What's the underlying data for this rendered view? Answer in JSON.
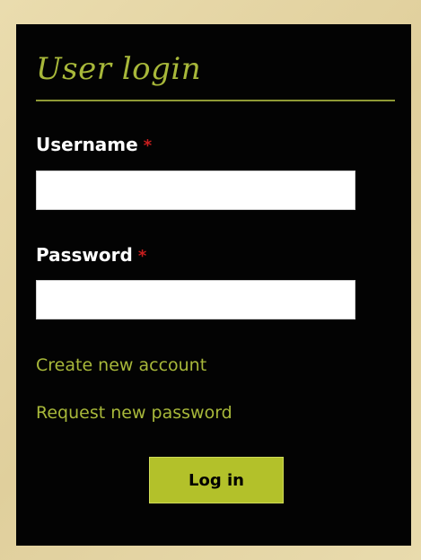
{
  "login_block": {
    "title": "User login",
    "username": {
      "label": "Username",
      "required_marker": "*",
      "value": ""
    },
    "password": {
      "label": "Password",
      "required_marker": "*",
      "value": ""
    },
    "links": {
      "create_account": "Create new account",
      "request_password": "Request new password"
    },
    "submit_label": "Log in"
  },
  "colors": {
    "background": "#e6d6a7",
    "panel": "#030303",
    "accent": "#a8b83a",
    "button": "#b3c12a",
    "required": "#c81e1e"
  }
}
